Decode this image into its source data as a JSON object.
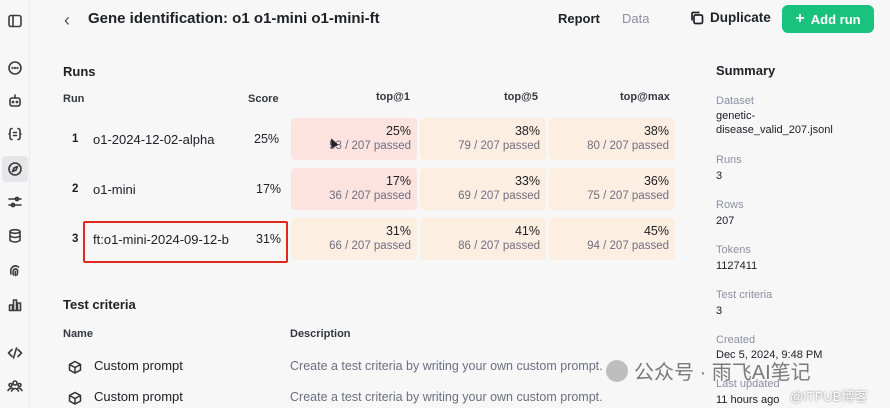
{
  "header": {
    "title": "Gene identification: o1 o1-mini o1-mini-ft",
    "tabs": [
      "Report",
      "Data"
    ],
    "duplicate_label": "Duplicate",
    "add_run_label": "Add run"
  },
  "runs": {
    "heading": "Runs",
    "columns": [
      "Run",
      "Score",
      "top@1",
      "top@5",
      "top@max"
    ],
    "rows": [
      {
        "num": "1",
        "name": "o1-2024-12-02-alpha",
        "score": "25%",
        "cells": [
          {
            "pct": "25%",
            "passed": "53 / 207 passed"
          },
          {
            "pct": "38%",
            "passed": "79 / 207 passed"
          },
          {
            "pct": "38%",
            "passed": "80 / 207 passed"
          }
        ]
      },
      {
        "num": "2",
        "name": "o1-mini",
        "score": "17%",
        "cells": [
          {
            "pct": "17%",
            "passed": "36 / 207 passed"
          },
          {
            "pct": "33%",
            "passed": "69 / 207 passed"
          },
          {
            "pct": "36%",
            "passed": "75 / 207 passed"
          }
        ]
      },
      {
        "num": "3",
        "name": "ft:o1-mini-2024-09-12-b",
        "score": "31%",
        "cells": [
          {
            "pct": "31%",
            "passed": "66 / 207 passed"
          },
          {
            "pct": "41%",
            "passed": "86 / 207 passed"
          },
          {
            "pct": "45%",
            "passed": "94 / 207 passed"
          }
        ]
      }
    ]
  },
  "criteria": {
    "heading": "Test criteria",
    "columns": [
      "Name",
      "Description"
    ],
    "rows": [
      {
        "name": "Custom prompt",
        "description": "Create a test criteria by writing your own custom prompt."
      },
      {
        "name": "Custom prompt",
        "description": "Create a test criteria by writing your own custom prompt."
      }
    ]
  },
  "summary": {
    "heading": "Summary",
    "dataset_label": "Dataset",
    "dataset_value_1": "genetic-",
    "dataset_value_2": "disease_valid_207.jsonl",
    "runs_label": "Runs",
    "runs_value": "3",
    "rows_label": "Rows",
    "rows_value": "207",
    "tokens_label": "Tokens",
    "tokens_value": "1127411",
    "criteria_label": "Test criteria",
    "criteria_value": "3",
    "created_label": "Created",
    "created_value": "Dec 5, 2024, 9:48 PM",
    "updated_label": "Last updated",
    "updated_value": "11 hours ago"
  },
  "watermark": {
    "text": "公众号 · 雨飞AI笔记",
    "sub": "@ITPUB博客"
  },
  "colors": {
    "accent_green": "#19c37d",
    "cell_red": "#fde3df",
    "cell_orange": "#fdeee2",
    "highlight_box": "#e0281f"
  },
  "icons": [
    "sidebar-toggle-icon",
    "chat-icon",
    "assistant-icon",
    "braces-icon",
    "compass-icon",
    "sliders-icon",
    "database-icon",
    "fingerprint-icon",
    "chart-icon",
    "code-icon",
    "users-icon",
    "chevron-left-icon",
    "copy-icon",
    "plus-icon",
    "cube-icon"
  ]
}
